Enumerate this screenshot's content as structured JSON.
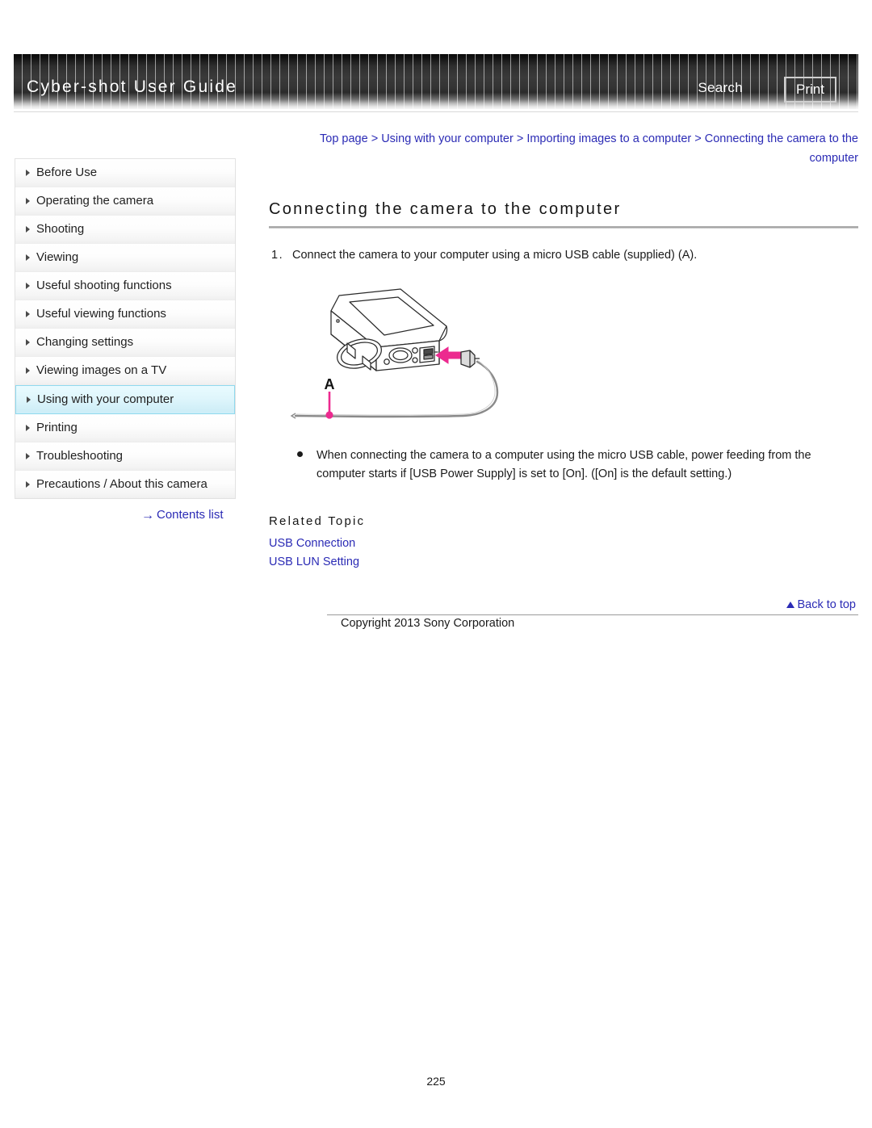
{
  "header": {
    "title": "Cyber-shot User Guide",
    "search_label": "Search",
    "print_label": "Print"
  },
  "breadcrumb": {
    "separator": ">",
    "items": [
      "Top page",
      "Using with your computer",
      "Importing images to a computer",
      "Connecting the camera to the computer"
    ]
  },
  "sidebar": {
    "items": [
      {
        "label": "Before Use",
        "selected": false
      },
      {
        "label": "Operating the camera",
        "selected": false
      },
      {
        "label": "Shooting",
        "selected": false
      },
      {
        "label": "Viewing",
        "selected": false
      },
      {
        "label": "Useful shooting functions",
        "selected": false
      },
      {
        "label": "Useful viewing functions",
        "selected": false
      },
      {
        "label": "Changing settings",
        "selected": false
      },
      {
        "label": "Viewing images on a TV",
        "selected": false
      },
      {
        "label": "Using with your computer",
        "selected": true
      },
      {
        "label": "Printing",
        "selected": false
      },
      {
        "label": "Troubleshooting",
        "selected": false
      },
      {
        "label": "Precautions / About this camera",
        "selected": false
      }
    ],
    "contents_list_label": "Contents list",
    "contents_list_arrow": "→"
  },
  "main": {
    "heading": "Connecting the camera to the computer",
    "step_number": "1.",
    "step_text": "Connect the camera to your computer using a micro USB cable (supplied) (A).",
    "figure_label": "A",
    "note": "When connecting the camera to a computer using the micro USB cable, power feeding from the computer starts if [USB Power Supply] is set to [On]. ([On] is the default setting.)",
    "related_topic_label": "Related Topic",
    "related_links": [
      "USB Connection",
      "USB LUN Setting"
    ]
  },
  "footer": {
    "back_to_top_label": "Back to top",
    "copyright": "Copyright 2013 Sony Corporation",
    "page_number": "225"
  },
  "colors": {
    "link_blue": "#2b2bb5",
    "accent_magenta": "#ec2a8f",
    "selected_cyan": "#cfeef7"
  }
}
